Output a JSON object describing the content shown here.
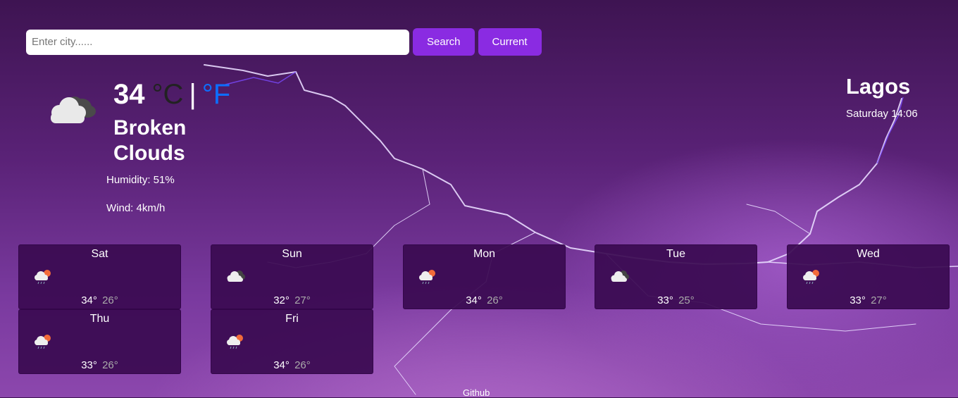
{
  "search": {
    "placeholder": "Enter city......",
    "value": ""
  },
  "buttons": {
    "search_label": "Search",
    "current_label": "Current"
  },
  "current": {
    "temperature": "34",
    "unit_c": "°C",
    "unit_separator": "|",
    "unit_f": "°F",
    "description": "Broken Clouds",
    "humidity": "Humidity: 51%",
    "wind": "Wind: 4km/h",
    "icon": "broken-clouds-icon"
  },
  "location": {
    "city": "Lagos",
    "datetime": "Saturday 14:06"
  },
  "forecast": [
    {
      "day": "Sat",
      "high": "34°",
      "low": "26°",
      "icon": "rain-sun-icon"
    },
    {
      "day": "Sun",
      "high": "32°",
      "low": "27°",
      "icon": "broken-clouds-icon"
    },
    {
      "day": "Mon",
      "high": "34°",
      "low": "26°",
      "icon": "rain-sun-icon"
    },
    {
      "day": "Tue",
      "high": "33°",
      "low": "25°",
      "icon": "broken-clouds-icon"
    },
    {
      "day": "Wed",
      "high": "33°",
      "low": "27°",
      "icon": "rain-sun-icon"
    },
    {
      "day": "Thu",
      "high": "33°",
      "low": "26°",
      "icon": "rain-sun-icon"
    },
    {
      "day": "Fri",
      "high": "34°",
      "low": "26°",
      "icon": "rain-sun-icon"
    }
  ],
  "footer": {
    "link": "Github"
  },
  "colors": {
    "accent": "#8a2be2",
    "unit_f": "#0d6efd",
    "card_bg": "#3a0a50"
  }
}
